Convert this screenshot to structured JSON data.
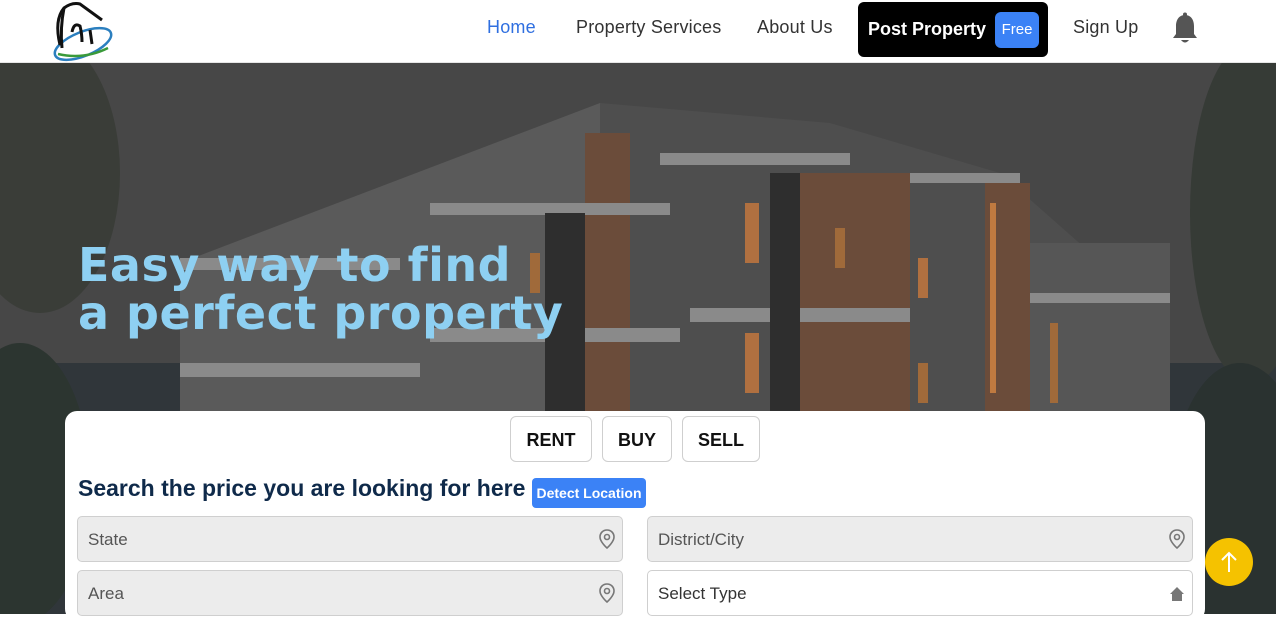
{
  "nav": {
    "home": "Home",
    "services": "Property Services",
    "about": "About Us",
    "post_property": "Post Property",
    "post_badge": "Free",
    "signup": "Sign Up"
  },
  "hero": {
    "title_line1": "Easy way to find",
    "title_line2": "a perfect property"
  },
  "search": {
    "tabs": [
      "RENT",
      "BUY",
      "SELL"
    ],
    "title": "Search the price you are looking for here",
    "detect_label": "Detect Location",
    "fields": {
      "state": "State",
      "district": "District/City",
      "area": "Area",
      "type": "Select Type"
    }
  },
  "colors": {
    "accent": "#3b82f6",
    "hero_title": "#8ed0f2",
    "scroll_button": "#f5c200"
  },
  "icons": [
    "house-logo-icon",
    "bell-icon",
    "location-pin-icon",
    "home-icon",
    "arrow-up-icon"
  ]
}
